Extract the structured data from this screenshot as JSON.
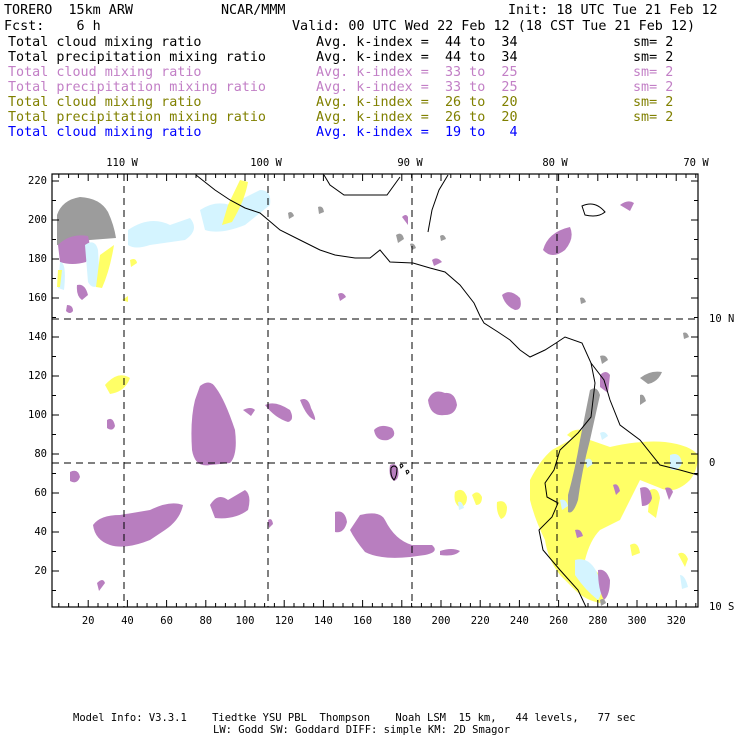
{
  "header": {
    "title": "TORERO  15km ARW",
    "center": "NCAR/MMM",
    "init": "Init: 18 UTC Tue 21 Feb 12",
    "fcst": "Fcst:    6 h",
    "valid": "Valid: 00 UTC Wed 22 Feb 12 (18 CST Tue 21 Feb 12)"
  },
  "legend": [
    {
      "field": "Total cloud mixing ratio",
      "kindex": "Avg. k-index =  44 to  34",
      "sm": "sm= 2",
      "color": "#000000"
    },
    {
      "field": "Total precipitation mixing ratio",
      "kindex": "Avg. k-index =  44 to  34",
      "sm": "sm= 2",
      "color": "#000000"
    },
    {
      "field": "Total cloud mixing ratio",
      "kindex": "Avg. k-index =  33 to  25",
      "sm": "sm= 2",
      "color": "#c27fc6"
    },
    {
      "field": "Total precipitation mixing ratio",
      "kindex": "Avg. k-index =  33 to  25",
      "sm": "sm= 2",
      "color": "#c27fc6"
    },
    {
      "field": "Total cloud mixing ratio",
      "kindex": "Avg. k-index =  26 to  20",
      "sm": "sm= 2",
      "color": "#808000"
    },
    {
      "field": "Total precipitation mixing ratio",
      "kindex": "Avg. k-index =  26 to  20",
      "sm": "sm= 2",
      "color": "#808000"
    },
    {
      "field": "Total cloud mixing ratio",
      "kindex": "Avg. k-index =  19 to   4",
      "sm": "",
      "color": "#0000ff"
    }
  ],
  "axes": {
    "x_ticks": [
      "20",
      "40",
      "60",
      "80",
      "100",
      "120",
      "140",
      "160",
      "180",
      "200",
      "220",
      "240",
      "260",
      "280",
      "300",
      "320"
    ],
    "y_ticks": [
      "20",
      "40",
      "60",
      "80",
      "100",
      "120",
      "140",
      "160",
      "180",
      "200",
      "220"
    ],
    "lon_labels": [
      "110 W",
      "100 W",
      "90 W",
      "80 W",
      "70 W"
    ],
    "lat_labels": [
      "10 N",
      "0",
      "10 S"
    ]
  },
  "colors": {
    "purple": "#b87ebf",
    "yellow": "#ffff66",
    "cyan": "#d4f4ff",
    "gray": "#9c9c9c"
  },
  "footer": {
    "line1": "Model Info: V3.3.1    Tiedtke YSU PBL  Thompson    Noah LSM  15 km,   44 levels,   77 sec",
    "line2": "LW: Godd SW: Goddard DIFF: simple KM: 2D Smagor"
  }
}
